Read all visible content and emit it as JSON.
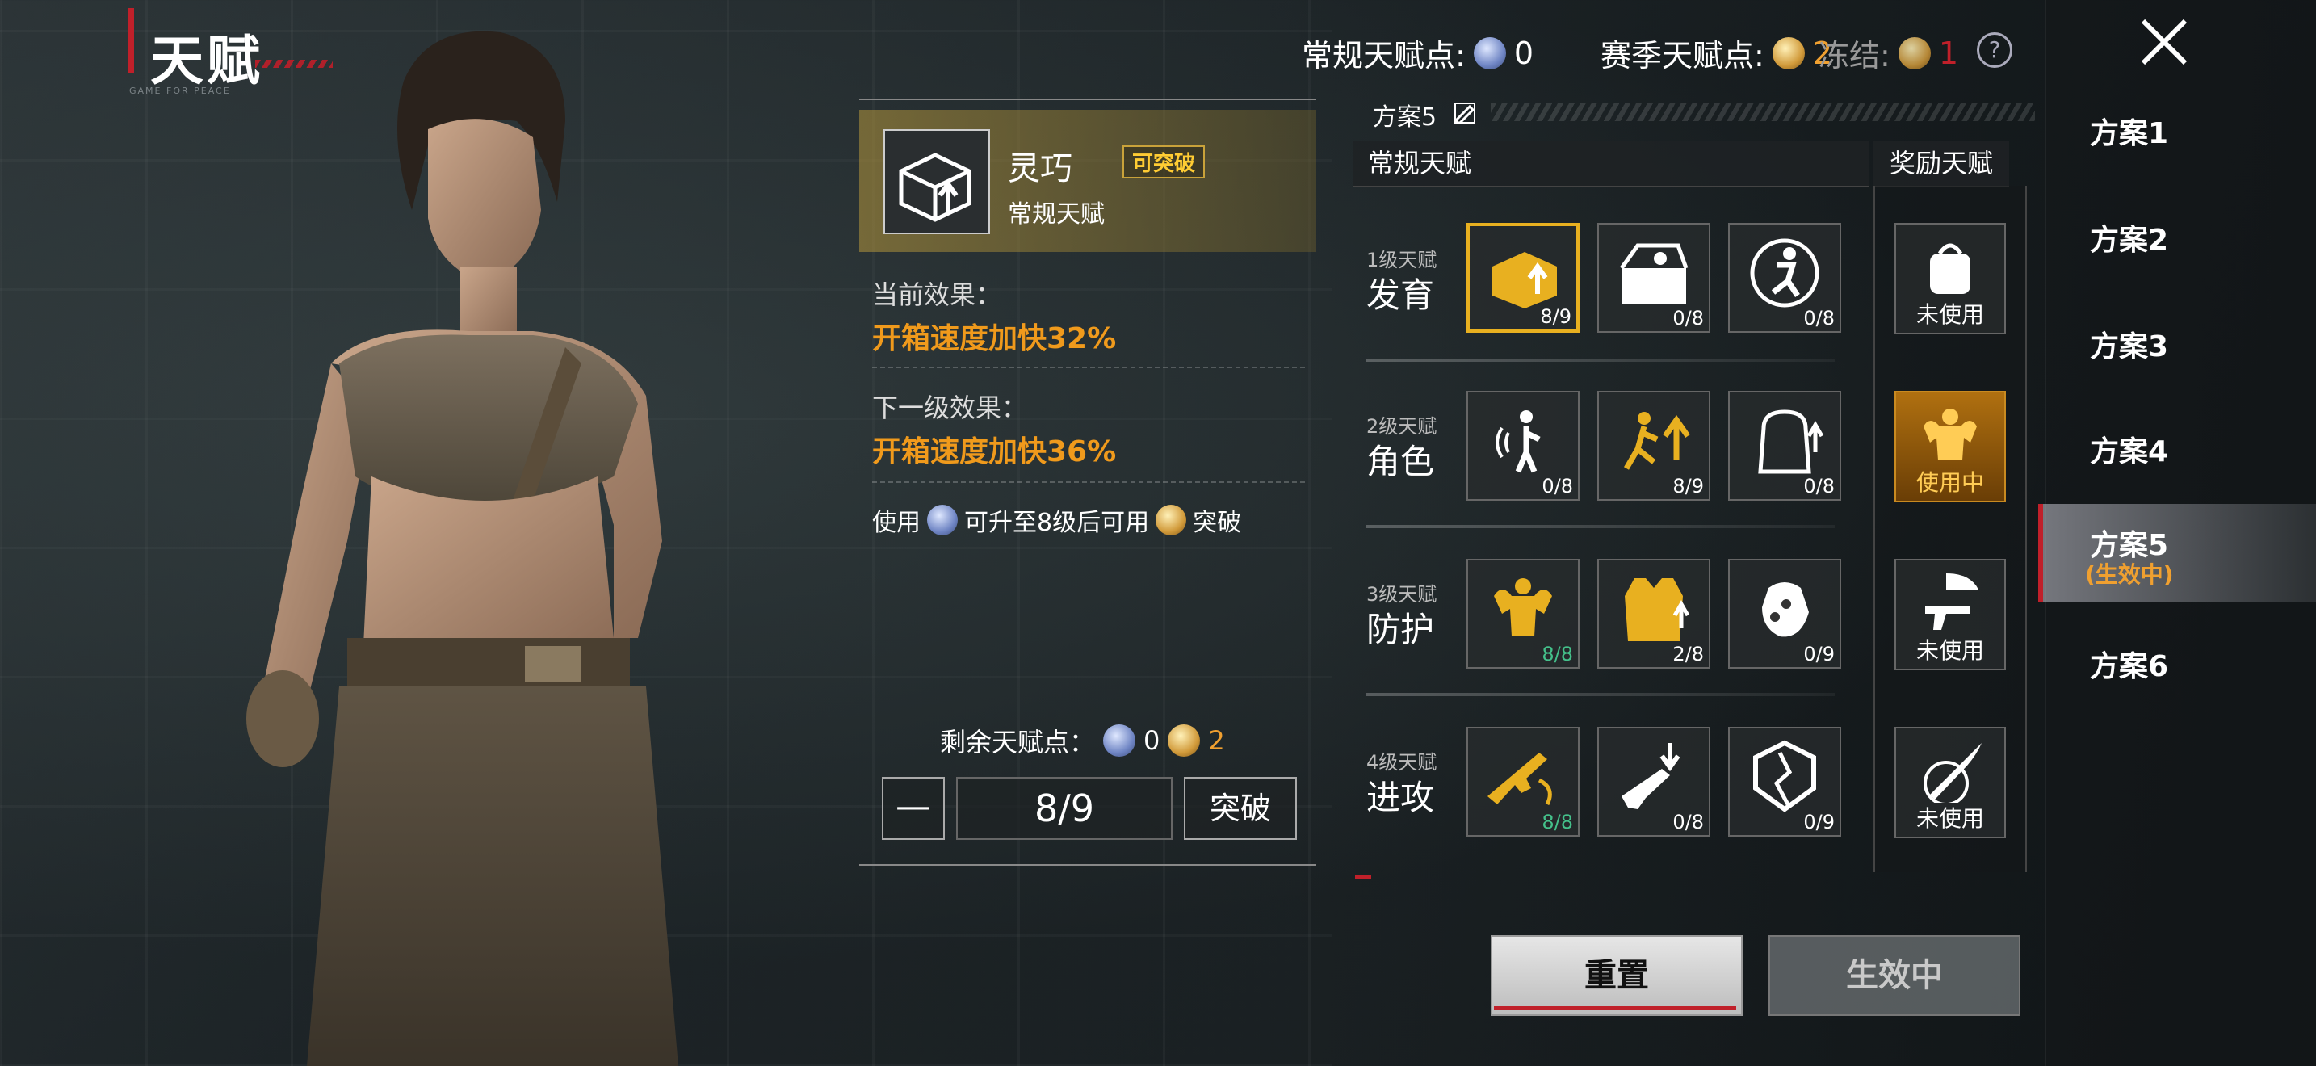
{
  "header": {
    "title": "天赋",
    "subtitle": "GAME FOR PEACE",
    "regular_points_label": "常规天赋点:",
    "regular_points_value": "0",
    "season_points_label": "赛季天赋点:",
    "season_points_value": "2",
    "frozen_label": "冻结:",
    "frozen_value": "1",
    "help": "?"
  },
  "plans": {
    "items": [
      {
        "label": "方案1"
      },
      {
        "label": "方案2"
      },
      {
        "label": "方案3"
      },
      {
        "label": "方案4"
      },
      {
        "label": "方案5",
        "status": "(生效中)"
      },
      {
        "label": "方案6"
      }
    ]
  },
  "detail": {
    "name": "灵巧",
    "breakable_tag": "可突破",
    "type": "常规天赋",
    "current_label": "当前效果：",
    "current_value": "开箱速度加快32%",
    "next_label": "下一级效果：",
    "next_value": "开箱速度加快36%",
    "note_use": "使用",
    "note_mid": "可升至8级后可用",
    "note_end": "突破",
    "remain_label": "剩余天赋点：",
    "remain_regular": "0",
    "remain_season": "2",
    "minus": "—",
    "count": "8/9",
    "break_button": "突破"
  },
  "tree": {
    "plan_name": "方案5",
    "regular_header": "常规天赋",
    "reward_header": "奖励天赋",
    "tiers": [
      {
        "small": "1级天赋",
        "big": "发育",
        "cells": [
          {
            "icon": "crate-icon",
            "count": "8/9",
            "full": false
          },
          {
            "icon": "supply-box-icon",
            "count": "0/8",
            "full": false
          },
          {
            "icon": "runner-icon",
            "count": "0/8",
            "full": false
          }
        ],
        "reward": {
          "icon": "backpack-icon",
          "status": "未使用"
        }
      },
      {
        "small": "2级天赋",
        "big": "角色",
        "cells": [
          {
            "icon": "sound-icon",
            "count": "0/8",
            "full": false
          },
          {
            "icon": "sprint-icon",
            "count": "8/9",
            "full": false
          },
          {
            "icon": "bag-icon",
            "count": "0/8",
            "full": false
          }
        ],
        "reward": {
          "icon": "strongman-icon",
          "status": "使用中"
        }
      },
      {
        "small": "3级天赋",
        "big": "防护",
        "cells": [
          {
            "icon": "muscle-icon",
            "count": "8/8",
            "full": true
          },
          {
            "icon": "vest-icon",
            "count": "2/8",
            "full": false
          },
          {
            "icon": "glove-icon",
            "count": "0/9",
            "full": false
          }
        ],
        "reward": {
          "icon": "airdrop-gun-icon",
          "status": "未使用"
        }
      },
      {
        "small": "4级天赋",
        "big": "进攻",
        "cells": [
          {
            "icon": "rifle-icon",
            "count": "8/8",
            "full": true
          },
          {
            "icon": "reload-icon",
            "count": "0/8",
            "full": false
          },
          {
            "icon": "shield-break-icon",
            "count": "0/9",
            "full": false
          }
        ],
        "reward": {
          "icon": "bullet-icon",
          "status": "未使用"
        }
      }
    ]
  },
  "buttons": {
    "reset": "重置",
    "active": "生效中"
  },
  "colors": {
    "accent_red": "#c0202a",
    "orange_value": "#f09a1c",
    "gold_tag": "#ffcc33",
    "full_green": "#44c08a"
  }
}
